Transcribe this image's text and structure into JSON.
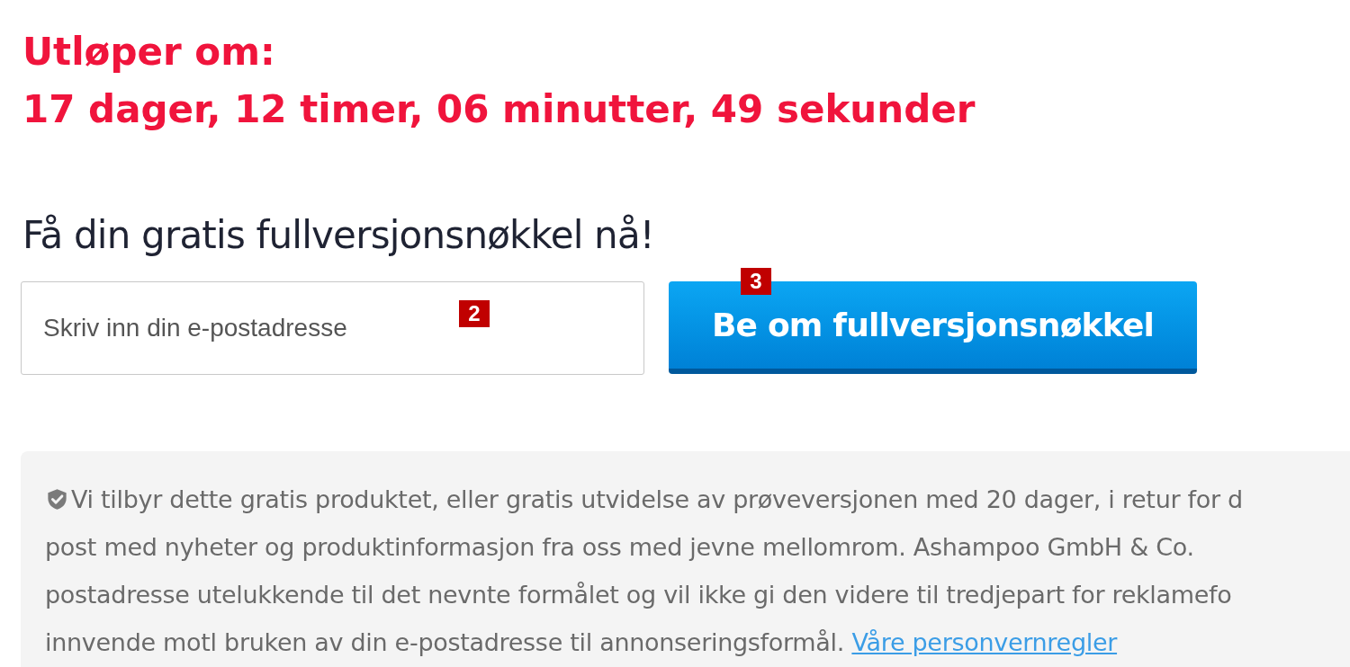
{
  "countdown": {
    "label": "Utløper om:",
    "remaining": "17 dager, 12 timer, 06 minutter, 49 sekunder"
  },
  "signup": {
    "heading": "Få din gratis fullversjonsnøkkel nå!",
    "email_field": {
      "placeholder": "Skriv inn din e-postadresse",
      "marker": "2"
    },
    "submit_button": {
      "label": "Be om fullversjonsnøkkel",
      "marker": "3"
    }
  },
  "notice": {
    "lines": [
      "Vi tilbyr dette gratis produktet, eller gratis utvidelse av prøveversjonen med 20 dager, i retur for d",
      "post med nyheter og produktinformasjon fra oss med jevne mellomrom. Ashampoo GmbH & Co.",
      "postadresse utelukkende til det nevnte formålet og vil ikke gi den videre til tredjepart for reklamefo",
      "innvende motl bruken av din e-postadresse til annonseringsformål."
    ],
    "link": "Våre personvernregler"
  }
}
